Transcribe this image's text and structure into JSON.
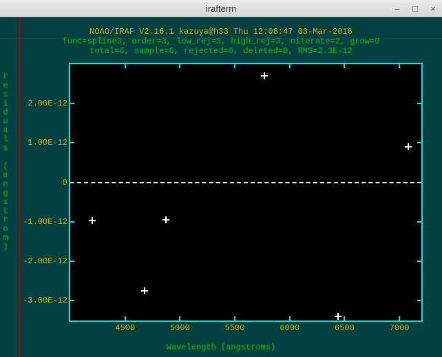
{
  "window": {
    "title": "irafterm"
  },
  "header": {
    "line1": "NOAO/IRAF V2.16.1 kazuya@h33 Thu 12:08:47 03-Mar-2016",
    "line2": "func=spline3, order=3, low_rej=3, high_rej=3, niterate=2, grow=0",
    "line3": "total=6, sample=6, rejected=0, deleted=0, RMS=2.3E-12"
  },
  "axes": {
    "y_letters": [
      "r",
      "e",
      "s",
      "i",
      "d",
      "u",
      "a",
      "l",
      "s",
      "",
      "(",
      "a",
      "n",
      "g",
      "s",
      "t",
      "r",
      "o",
      "m",
      ")"
    ],
    "x_label": "Wavelength (angstroms)"
  },
  "chart_data": {
    "type": "scatter",
    "title": "residuals vs wavelength",
    "xlabel": "Wavelength (angstroms)",
    "ylabel": "residuals (angstrom)",
    "xlim": [
      4000,
      7200
    ],
    "ylim": [
      -3.5e-12,
      3e-12
    ],
    "x_ticks": [
      4500,
      5000,
      5500,
      6000,
      6500,
      7000
    ],
    "y_ticks": [
      {
        "v": 2e-12,
        "label": "2.00E-12"
      },
      {
        "v": 1e-12,
        "label": "1.00E-12"
      },
      {
        "v": 0,
        "label": "0"
      },
      {
        "v": -1e-12,
        "label": "-1.00E-12"
      },
      {
        "v": -2e-12,
        "label": "-2.00E-12"
      },
      {
        "v": -3e-12,
        "label": "-3.00E-12"
      }
    ],
    "points": [
      {
        "x": 4200,
        "y": -9.7e-13
      },
      {
        "x": 4680,
        "y": -2.75e-12
      },
      {
        "x": 4870,
        "y": -9.5e-13
      },
      {
        "x": 5770,
        "y": 2.7e-12
      },
      {
        "x": 6440,
        "y": -3.4e-12
      },
      {
        "x": 7080,
        "y": 9e-13
      }
    ],
    "zero_line": true,
    "rms": 2.3e-12
  }
}
